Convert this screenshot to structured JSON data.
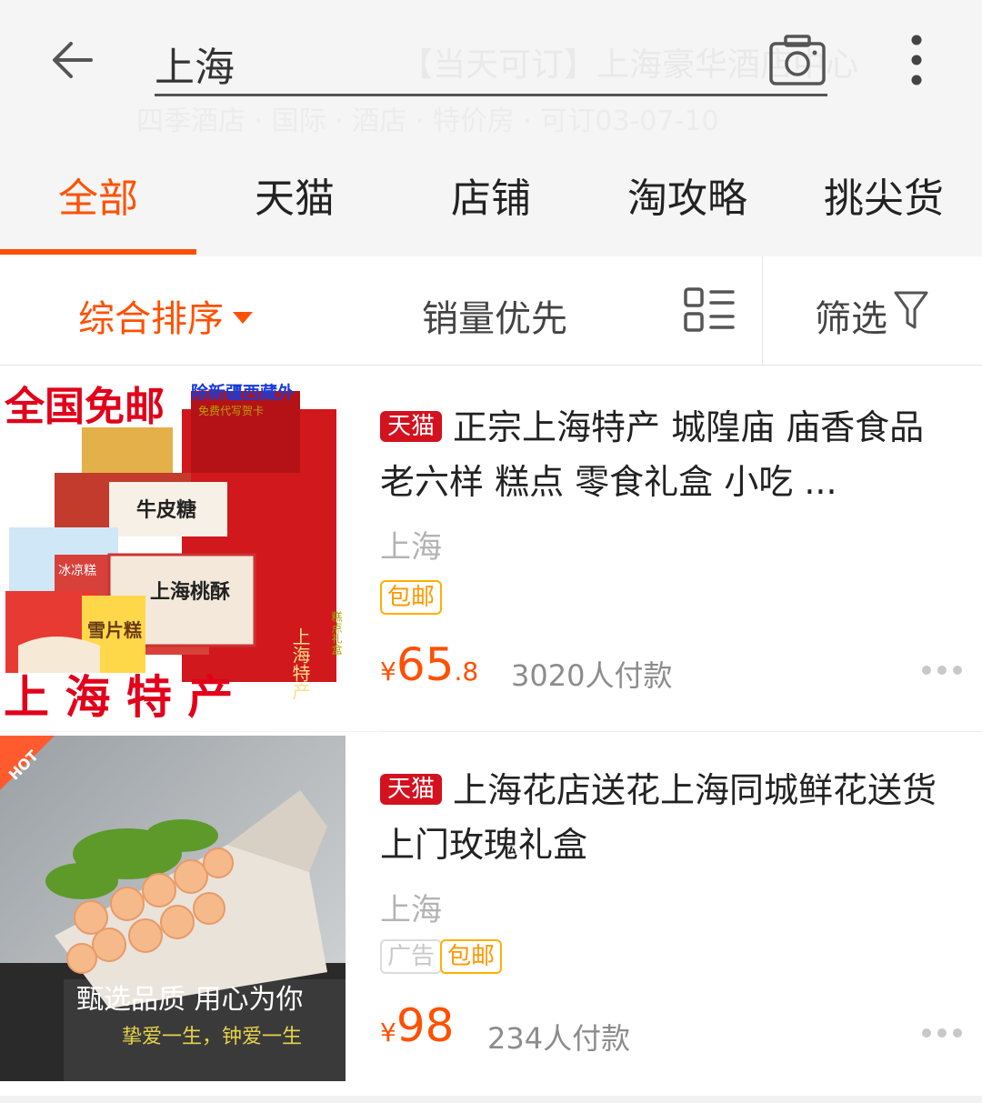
{
  "search": {
    "query": "上海",
    "overlay_text_1": "【当天可订】上海豪华酒店中心",
    "overlay_text_2": "四季酒店 · 国际 · 酒店 · 特价房 · 可订03-07-10"
  },
  "tabs": [
    {
      "label": "全部",
      "active": true
    },
    {
      "label": "天猫",
      "active": false
    },
    {
      "label": "店铺",
      "active": false
    },
    {
      "label": "淘攻略",
      "active": false
    },
    {
      "label": "挑尖货",
      "active": false
    }
  ],
  "sort": {
    "comprehensive": "综合排序",
    "sales": "销量优先",
    "filter": "筛选"
  },
  "products": [
    {
      "badge": "天猫",
      "title": "正宗上海特产 城隍庙 庙香食品 老六样 糕点 零食礼盒 小吃 ...",
      "location": "上海",
      "tags": [
        "包邮"
      ],
      "price_yen": "¥",
      "price_int": "65",
      "price_dec": ".8",
      "sold": "3020人付款",
      "image_text": {
        "banner": "全国免邮",
        "corner": "除新疆西藏外",
        "corner_sub": "免费代写贺卡",
        "bottom": "上 海 特 产",
        "box1": "牛皮糖",
        "box2": "上海桃酥",
        "box3": "雪片糕",
        "box4": "冰凉糕",
        "bag": "上海特产",
        "bag_side": "糕点礼盒"
      }
    },
    {
      "badge": "天猫",
      "title": "上海花店送花上海同城鲜花送货上门玫瑰礼盒",
      "location": "上海",
      "tags": [
        "广告",
        "包邮"
      ],
      "price_yen": "¥",
      "price_int": "98",
      "price_dec": "",
      "sold": "234人付款",
      "image_text": {
        "hot": "HOT",
        "slogan": "甄选品质  用心为你",
        "sub": "挚爱一生，钟爱一生"
      }
    }
  ],
  "colors": {
    "accent": "#ff5000",
    "tmall_red": "#d4111f",
    "free_ship": "#ff9800"
  }
}
